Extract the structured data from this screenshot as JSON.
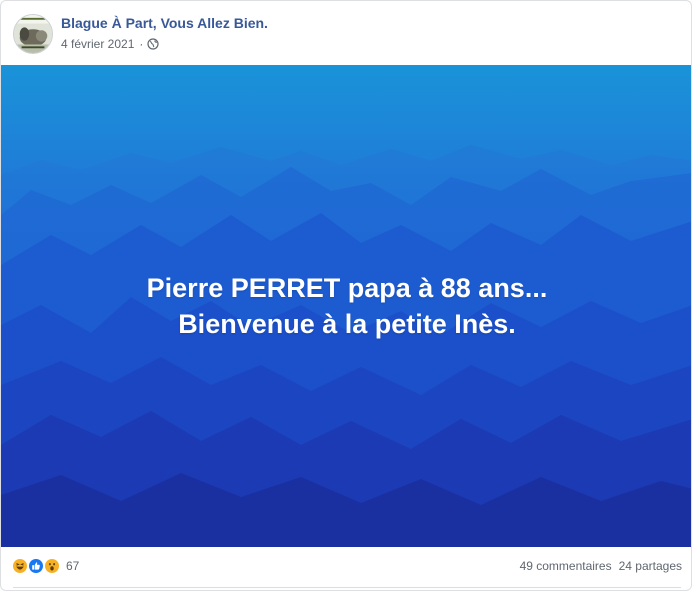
{
  "post": {
    "page_name": "Blague À Part, Vous Allez Bien.",
    "date": "4 février 2021",
    "separator": "·",
    "privacy_icon": "globe-icon",
    "avatar_icon": "page-avatar"
  },
  "image": {
    "line1": "Pierre PERRET papa à 88 ans...",
    "line2": "Bienvenue à la petite Inès."
  },
  "footer": {
    "reaction_icons": [
      "haha-icon",
      "like-icon",
      "wow-icon"
    ],
    "reaction_count": "67",
    "comments": "49 commentaires",
    "shares": "24 partages"
  },
  "colors": {
    "page_name": "#385898",
    "meta_text": "#606770",
    "image_top": "#1a93d8",
    "image_bottom": "#1b33a8",
    "like_blue": "#1877f2",
    "haha_yellow": "#f7b125"
  }
}
